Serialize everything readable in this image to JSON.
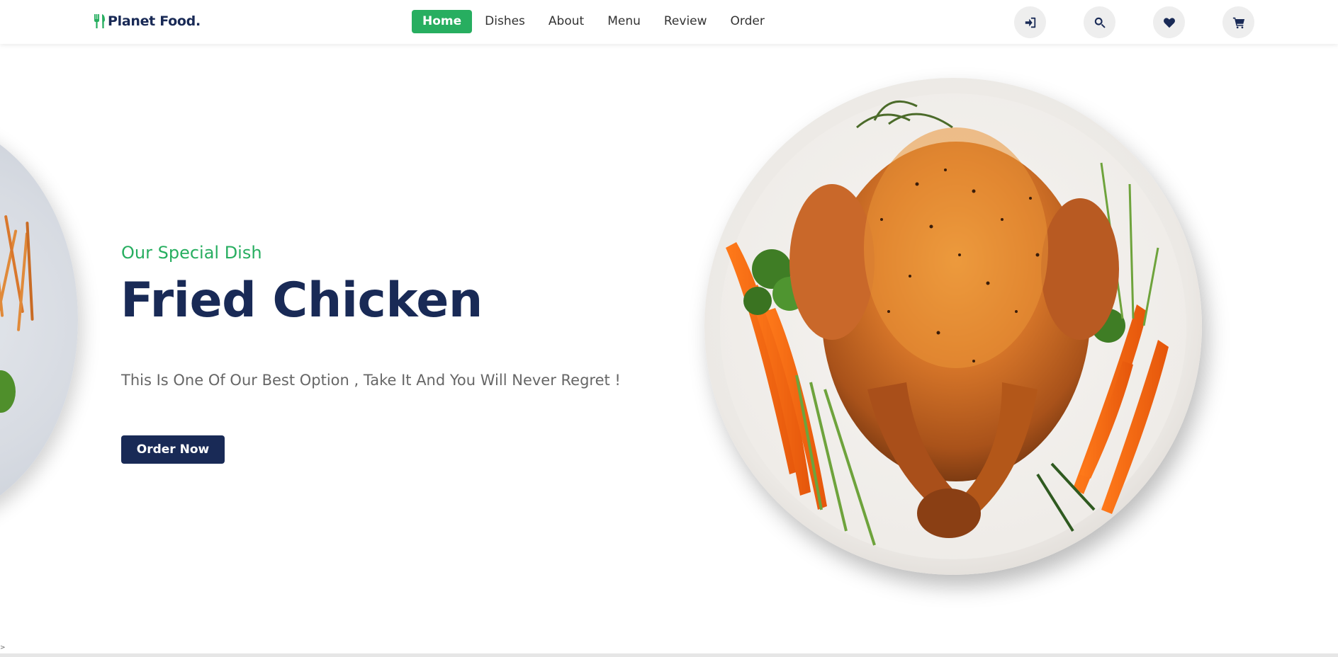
{
  "brand": {
    "name": "Planet Food."
  },
  "nav": {
    "items": [
      {
        "label": "Home",
        "active": true
      },
      {
        "label": "Dishes",
        "active": false
      },
      {
        "label": "About",
        "active": false
      },
      {
        "label": "Menu",
        "active": false
      },
      {
        "label": "Review",
        "active": false
      },
      {
        "label": "Order",
        "active": false
      }
    ]
  },
  "header_icons": [
    "sign-in-icon",
    "search-icon",
    "heart-icon",
    "cart-icon"
  ],
  "hero": {
    "subtitle": "Our Special Dish",
    "title": "Fried Chicken",
    "description": "This Is One Of Our Best Option , Take It And You Will Never Regret !",
    "cta_label": "Order Now"
  },
  "footer": {
    "caret": ">"
  },
  "colors": {
    "accent": "#27ae60",
    "primary": "#192a56",
    "text_muted": "#666666",
    "icon_bg": "#eeeeee"
  }
}
